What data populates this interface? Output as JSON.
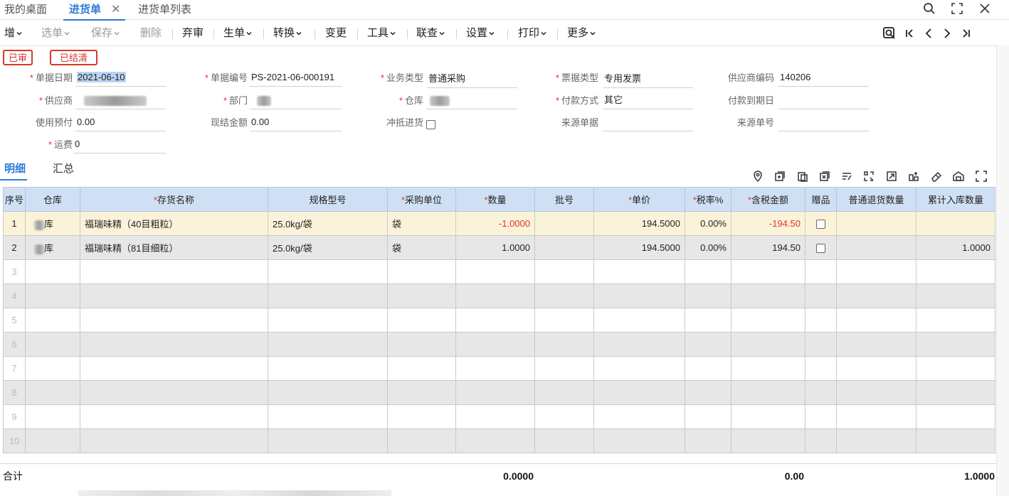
{
  "tabs": [
    {
      "label": "我的桌面"
    },
    {
      "label": "进货单"
    },
    {
      "label": "进货单列表"
    }
  ],
  "tab_close_glyph": "✕",
  "window_icons": [
    "search-icon",
    "fullscreen-icon",
    "close-icon"
  ],
  "toolbar": {
    "items": [
      {
        "label": "增",
        "dropdown": true,
        "disabled": false
      },
      {
        "label": "选单",
        "dropdown": true,
        "disabled": true
      },
      {
        "label": "保存",
        "dropdown": true,
        "disabled": true
      },
      {
        "label": "删除",
        "dropdown": false,
        "disabled": true
      },
      {
        "label": "弃审",
        "dropdown": false,
        "disabled": false
      },
      {
        "label": "生单",
        "dropdown": true,
        "disabled": false
      },
      {
        "label": "转换",
        "dropdown": true,
        "disabled": false
      },
      {
        "label": "变更",
        "dropdown": false,
        "disabled": false
      },
      {
        "label": "工具",
        "dropdown": true,
        "disabled": false
      },
      {
        "label": "联查",
        "dropdown": true,
        "disabled": false
      },
      {
        "label": "设置",
        "dropdown": true,
        "disabled": false
      },
      {
        "label": "打印",
        "dropdown": true,
        "disabled": false
      },
      {
        "label": "更多",
        "dropdown": true,
        "disabled": false
      }
    ],
    "nav_icons": [
      "find-icon",
      "first-record-icon",
      "previous-record-icon",
      "next-record-icon",
      "last-record-icon"
    ]
  },
  "status_badges": [
    "已审",
    "已结清"
  ],
  "form": {
    "doc_date": {
      "label": "单据日期",
      "value": "2021-06-10",
      "required": true
    },
    "doc_no": {
      "label": "单据编号",
      "value": "PS-2021-06-000191",
      "required": true
    },
    "biz_type": {
      "label": "业务类型",
      "value": "普通采购",
      "required": true
    },
    "invoice_type": {
      "label": "票据类型",
      "value": "专用发票",
      "required": true
    },
    "supplier_code": {
      "label": "供应商编码",
      "value": "140206",
      "required": false
    },
    "supplier": {
      "label": "供应商",
      "value": "",
      "required": true
    },
    "department": {
      "label": "部门",
      "value": "",
      "required": true
    },
    "warehouse": {
      "label": "仓库",
      "value": "",
      "required": true
    },
    "payment_method": {
      "label": "付款方式",
      "value": "其它",
      "required": true
    },
    "payment_due": {
      "label": "付款到期日",
      "value": "",
      "required": false
    },
    "prepay": {
      "label": "使用预付",
      "value": "0.00",
      "required": false
    },
    "cash_amount": {
      "label": "现结金额",
      "value": "0.00",
      "required": false
    },
    "offset_purchase": {
      "label": "冲抵进货",
      "checked": false,
      "required": false
    },
    "source_doc": {
      "label": "来源单据",
      "value": "",
      "required": false
    },
    "source_no": {
      "label": "来源单号",
      "value": "",
      "required": false
    },
    "freight": {
      "label": "运费",
      "value": "0",
      "required": true
    }
  },
  "detail_tabs": [
    "明细",
    "汇总"
  ],
  "grid_icons": [
    "location-icon",
    "insert-row-icon",
    "copy-row-icon",
    "delete-row-icon",
    "batch-edit-icon",
    "scan-icon",
    "export-icon",
    "split-icon",
    "eraser-icon",
    "warehouse-icon",
    "expand-icon"
  ],
  "grid": {
    "columns": [
      {
        "label": "序号",
        "required": false
      },
      {
        "label": "仓库",
        "required": false
      },
      {
        "label": "存货名称",
        "required": true
      },
      {
        "label": "规格型号",
        "required": false
      },
      {
        "label": "采购单位",
        "required": true
      },
      {
        "label": "数量",
        "required": true
      },
      {
        "label": "批号",
        "required": false
      },
      {
        "label": "单价",
        "required": true
      },
      {
        "label": "税率%",
        "required": true
      },
      {
        "label": "含税金额",
        "required": true
      },
      {
        "label": "赠品",
        "required": false
      },
      {
        "label": "普通退货数量",
        "required": false
      },
      {
        "label": "累计入库数量",
        "required": false
      }
    ],
    "rows": [
      {
        "idx": "1",
        "warehouse_suffix": "库",
        "name": "福瑞味精（40目粗粒）",
        "spec": "25.0kg/袋",
        "unit": "袋",
        "qty": "-1.0000",
        "batch": "",
        "price": "194.5000",
        "tax": "0.00%",
        "amount": "-194.50",
        "gift": false,
        "return_qty": "",
        "in_qty": ""
      },
      {
        "idx": "2",
        "warehouse_suffix": "库",
        "name": "福瑞味精（81目细粒）",
        "spec": "25.0kg/袋",
        "unit": "袋",
        "qty": "1.0000",
        "batch": "",
        "price": "194.5000",
        "tax": "0.00%",
        "amount": "194.50",
        "gift": false,
        "return_qty": "",
        "in_qty": "1.0000"
      }
    ],
    "empty_rows": [
      "3",
      "4",
      "5",
      "6",
      "7",
      "8",
      "9",
      "10"
    ]
  },
  "totals": {
    "label": "合计",
    "qty": "0.0000",
    "amount": "0.00",
    "in_qty": "1.0000"
  },
  "colors": {
    "accent": "#2f7bd6",
    "required": "#e0342a",
    "header_bg": "#cfe0f4",
    "selected_row": "#fbf3d9"
  }
}
